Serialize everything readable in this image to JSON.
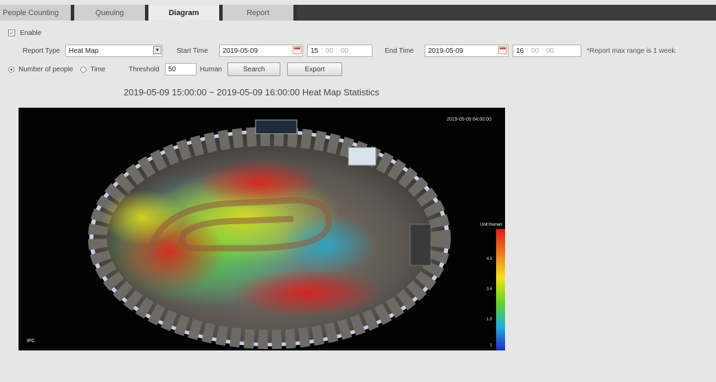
{
  "tabs": [
    {
      "label": "People Counting",
      "active": false
    },
    {
      "label": "Queuing",
      "active": false
    },
    {
      "label": "Diagram",
      "active": true
    },
    {
      "label": "Report",
      "active": false
    }
  ],
  "form": {
    "enable_label": "Enable",
    "enable_checked": true,
    "report_type_label": "Report Type",
    "report_type_value": "Heat Map",
    "start_time_label": "Start Time",
    "start_date": "2019-05-09",
    "start_hour": "15",
    "start_min": "00",
    "start_sec": "00",
    "end_time_label": "End Time",
    "end_date": "2019-05-09",
    "end_hour": "16",
    "end_min": "00",
    "end_sec": "00",
    "range_note": "*Report max range is 1 week.",
    "number_of_people_label": "Number of people",
    "time_label": "Time",
    "mode_selected": "Number of people",
    "threshold_label": "Threshold",
    "threshold_value": "50",
    "threshold_unit": "Human",
    "search_label": "Search",
    "export_label": "Export"
  },
  "heatmap": {
    "title": "2019-05-09 15:00:00 ~ 2019-05-09 16:00:00 Heat Map Statistics",
    "timestamp": "2019-05-09 04:00:00",
    "legend_unit": "Unit:Human",
    "legend_ticks": [
      "4.9",
      "3.6",
      "1.5",
      "1"
    ],
    "corner_label": "IPC",
    "colors": {
      "red": "#e61919",
      "orange": "#f07a16",
      "yellow": "#f2e511",
      "green": "#69d61c",
      "cyan": "#1bb3d9",
      "blue": "#1a2ad6"
    }
  }
}
